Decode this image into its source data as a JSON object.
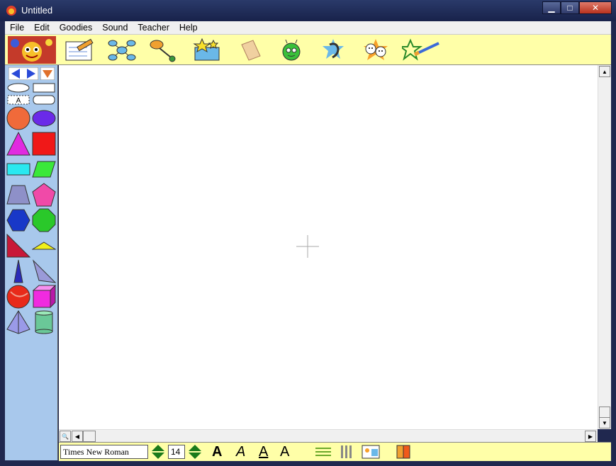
{
  "window": {
    "title": "Untitled"
  },
  "menu": [
    "File",
    "Edit",
    "Goodies",
    "Sound",
    "Teacher",
    "Help"
  ],
  "toolbar": {
    "icons": [
      "notepad-pencil-icon",
      "network-icon",
      "arrow-link-icon",
      "goodies-box-icon",
      "eraser-icon",
      "bug-face-icon",
      "ear-icon",
      "faces-icon",
      "paintbrush-icon"
    ]
  },
  "shapes_palette": [
    "oval-outline",
    "rectangle-outline",
    "text-box",
    "rounded-rectangle",
    "orange-circle",
    "purple-ellipse",
    "magenta-triangle",
    "red-square",
    "cyan-rectangle",
    "green-parallelogram",
    "trapezoid",
    "pink-pentagon",
    "blue-hexagon",
    "green-octagon",
    "right-triangle",
    "yellow-flat-triangle",
    "blue-cone",
    "lavender-triangle",
    "red-sphere",
    "magenta-cube",
    "lavender-pyramid",
    "green-cylinder"
  ],
  "colors": {
    "toolbar_bg": "#ffffa8",
    "palette_bg": "#a8c8ec"
  },
  "format": {
    "font": "Times New Roman",
    "size": "14",
    "bold": "A",
    "italic": "A",
    "underline": "A",
    "style": "A"
  }
}
